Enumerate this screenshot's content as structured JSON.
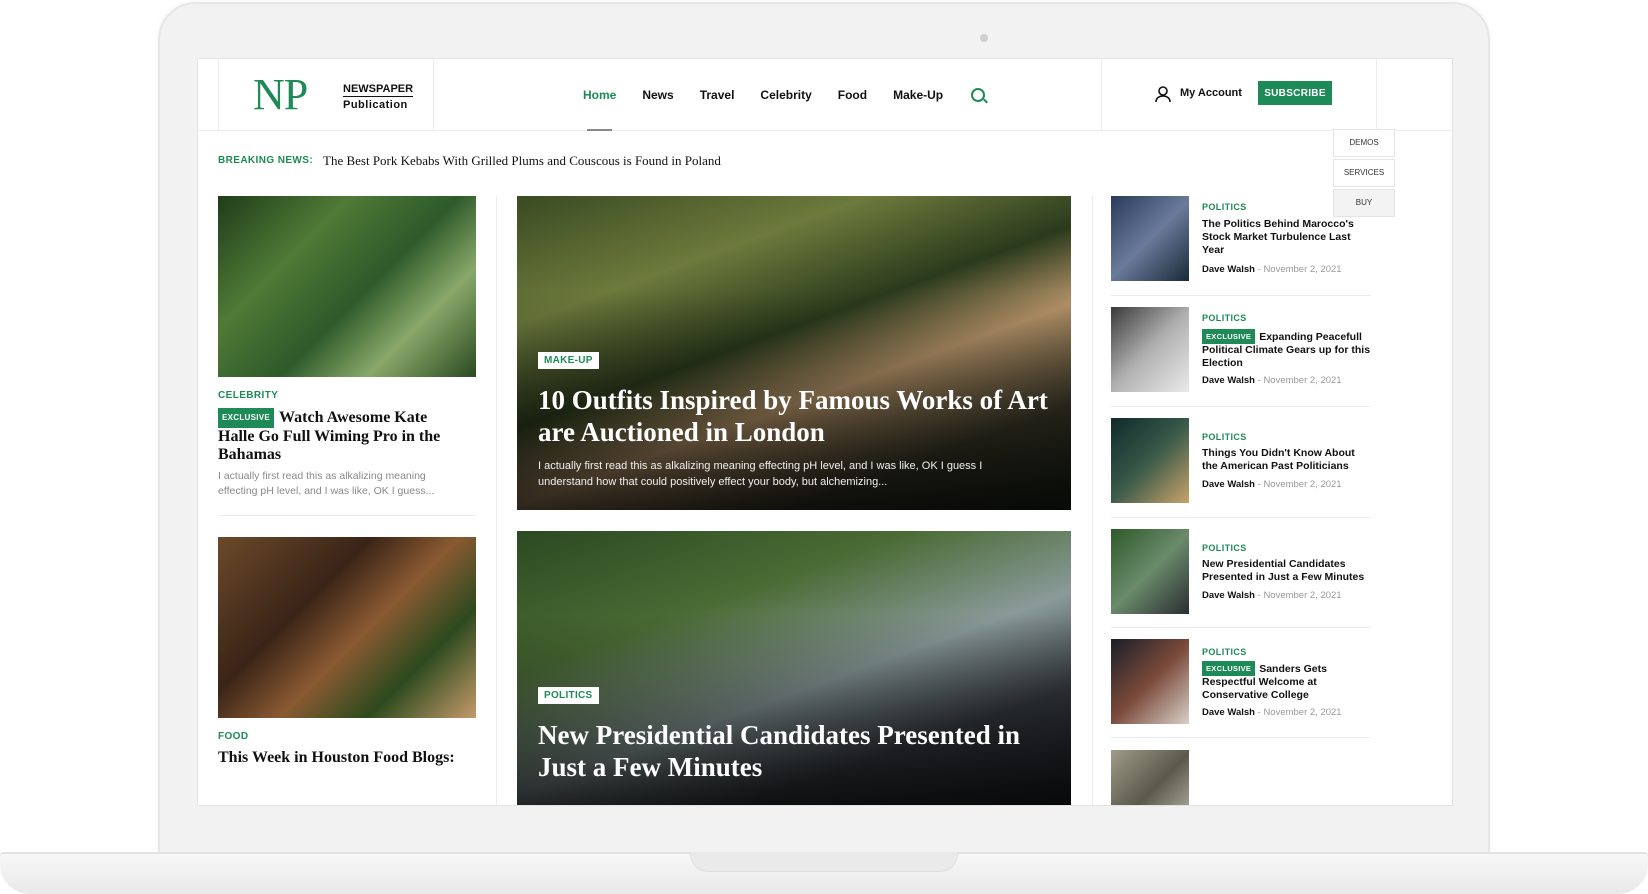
{
  "logo": {
    "mark": "NP",
    "line1": "NEWSPAPER",
    "line2": "Publication"
  },
  "nav": {
    "items": [
      "Home",
      "News",
      "Travel",
      "Celebrity",
      "Food",
      "Make-Up"
    ],
    "active": "Home"
  },
  "header": {
    "account_label": "My Account",
    "subscribe_label": "SUBSCRIBE"
  },
  "side_panel": {
    "demos": "DEMOS",
    "services": "SERVICES",
    "buy": "BUY"
  },
  "breaking": {
    "label": "BREAKING NEWS:",
    "headline": "The Best Pork Kebabs With Grilled Plums and Couscous is Found in Poland"
  },
  "left_column": {
    "post1": {
      "category": "CELEBRITY",
      "badge": "EXCLUSIVE",
      "title": "Watch Awesome Kate Halle Go Full Wiming Pro in the Bahamas",
      "excerpt": "I actually first read this as alkalizing meaning effecting pH level, and I was like, OK I guess..."
    },
    "post2": {
      "category": "FOOD",
      "title": "This Week in Houston Food Blogs:"
    }
  },
  "hero": {
    "card1": {
      "tag": "MAKE-UP",
      "title": "10 Outfits Inspired by Famous Works of Art are Auctioned in London",
      "excerpt": "I actually first read this as alkalizing meaning effecting pH level, and I was like, OK I guess I understand how that could positively effect your body, but alchemizing..."
    },
    "card2": {
      "tag": "POLITICS",
      "title": "New Presidential Candidates Presented in Just a Few Minutes"
    }
  },
  "right_column": [
    {
      "category": "POLITICS",
      "badge": "",
      "title": "The Politics Behind Marocco's Stock Market Turbulence Last Year",
      "author": "Dave Walsh",
      "date": "November 2, 2021"
    },
    {
      "category": "POLITICS",
      "badge": "EXCLUSIVE",
      "title": "Expanding Peacefull Political Climate Gears up for this Election",
      "author": "Dave Walsh",
      "date": "November 2, 2021"
    },
    {
      "category": "POLITICS",
      "badge": "",
      "title": "Things You Didn't Know About the American Past Politicians",
      "author": "Dave Walsh",
      "date": "November 2, 2021"
    },
    {
      "category": "POLITICS",
      "badge": "",
      "title": "New Presidential Candidates Presented in Just a Few Minutes",
      "author": "Dave Walsh",
      "date": "November 2, 2021"
    },
    {
      "category": "POLITICS",
      "badge": "EXCLUSIVE",
      "title": "Sanders Gets Respectful Welcome at Conservative College",
      "author": "Dave Walsh",
      "date": "November 2, 2021"
    }
  ],
  "meta_separator": "-",
  "colors": {
    "accent": "#1e8a57",
    "text": "#111111",
    "muted": "#999999"
  }
}
